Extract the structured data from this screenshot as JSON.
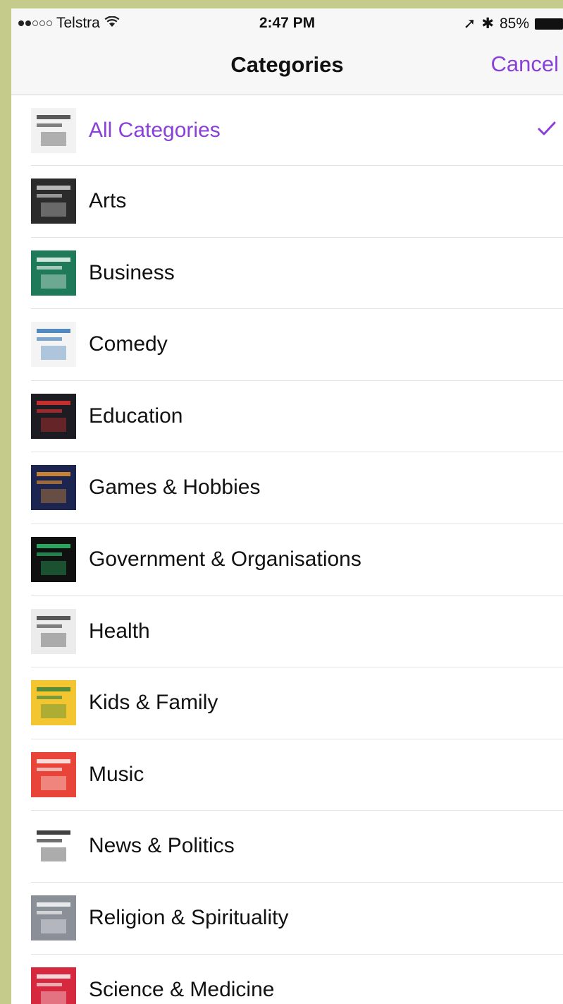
{
  "statusbar": {
    "carrier": "Telstra",
    "time": "2:47 PM",
    "battery": "85%",
    "location_glyph": "➚",
    "bluetooth_glyph": "✱"
  },
  "nav": {
    "title": "Categories",
    "cancel": "Cancel"
  },
  "accent": "#8b3fd9",
  "categories": [
    {
      "label": "All Categories",
      "selected": true,
      "art": "malcolm-gladwell-revisionist-history",
      "bg": "#f2f2f2",
      "fg": "#333"
    },
    {
      "label": "Arts",
      "selected": false,
      "art": "myths-legends",
      "bg": "#2b2b2b",
      "fg": "#ddd"
    },
    {
      "label": "Business",
      "selected": false,
      "art": "planet-money",
      "bg": "#1f7a5a",
      "fg": "#fff"
    },
    {
      "label": "Comedy",
      "selected": false,
      "art": "comedy-podcast",
      "bg": "#f4f4f4",
      "fg": "#2a6fb0"
    },
    {
      "label": "Education",
      "selected": false,
      "art": "ted-radio-hour",
      "bg": "#1c1c22",
      "fg": "#e33"
    },
    {
      "label": "Games & Hobbies",
      "selected": false,
      "art": "soup-podcast",
      "bg": "#1b2550",
      "fg": "#f39a2d"
    },
    {
      "label": "Government & Organisations",
      "selected": false,
      "art": "more-perfect",
      "bg": "#101010",
      "fg": "#2ecc71"
    },
    {
      "label": "Health",
      "selected": false,
      "art": "inspirational-lives",
      "bg": "#ececec",
      "fg": "#333"
    },
    {
      "label": "Kids & Family",
      "selected": false,
      "art": "story-podcast",
      "bg": "#f2c531",
      "fg": "#2d7d3a"
    },
    {
      "label": "Music",
      "selected": false,
      "art": "like-a-version",
      "bg": "#e8443a",
      "fg": "#fff"
    },
    {
      "label": "News & Politics",
      "selected": false,
      "art": "serial",
      "bg": "#ffffff",
      "fg": "#111"
    },
    {
      "label": "Religion & Spirituality",
      "selected": false,
      "art": "portrait",
      "bg": "#8a8f98",
      "fg": "#fff"
    },
    {
      "label": "Science & Medicine",
      "selected": false,
      "art": "all-in-the-mind",
      "bg": "#d6283e",
      "fg": "#fff"
    }
  ]
}
